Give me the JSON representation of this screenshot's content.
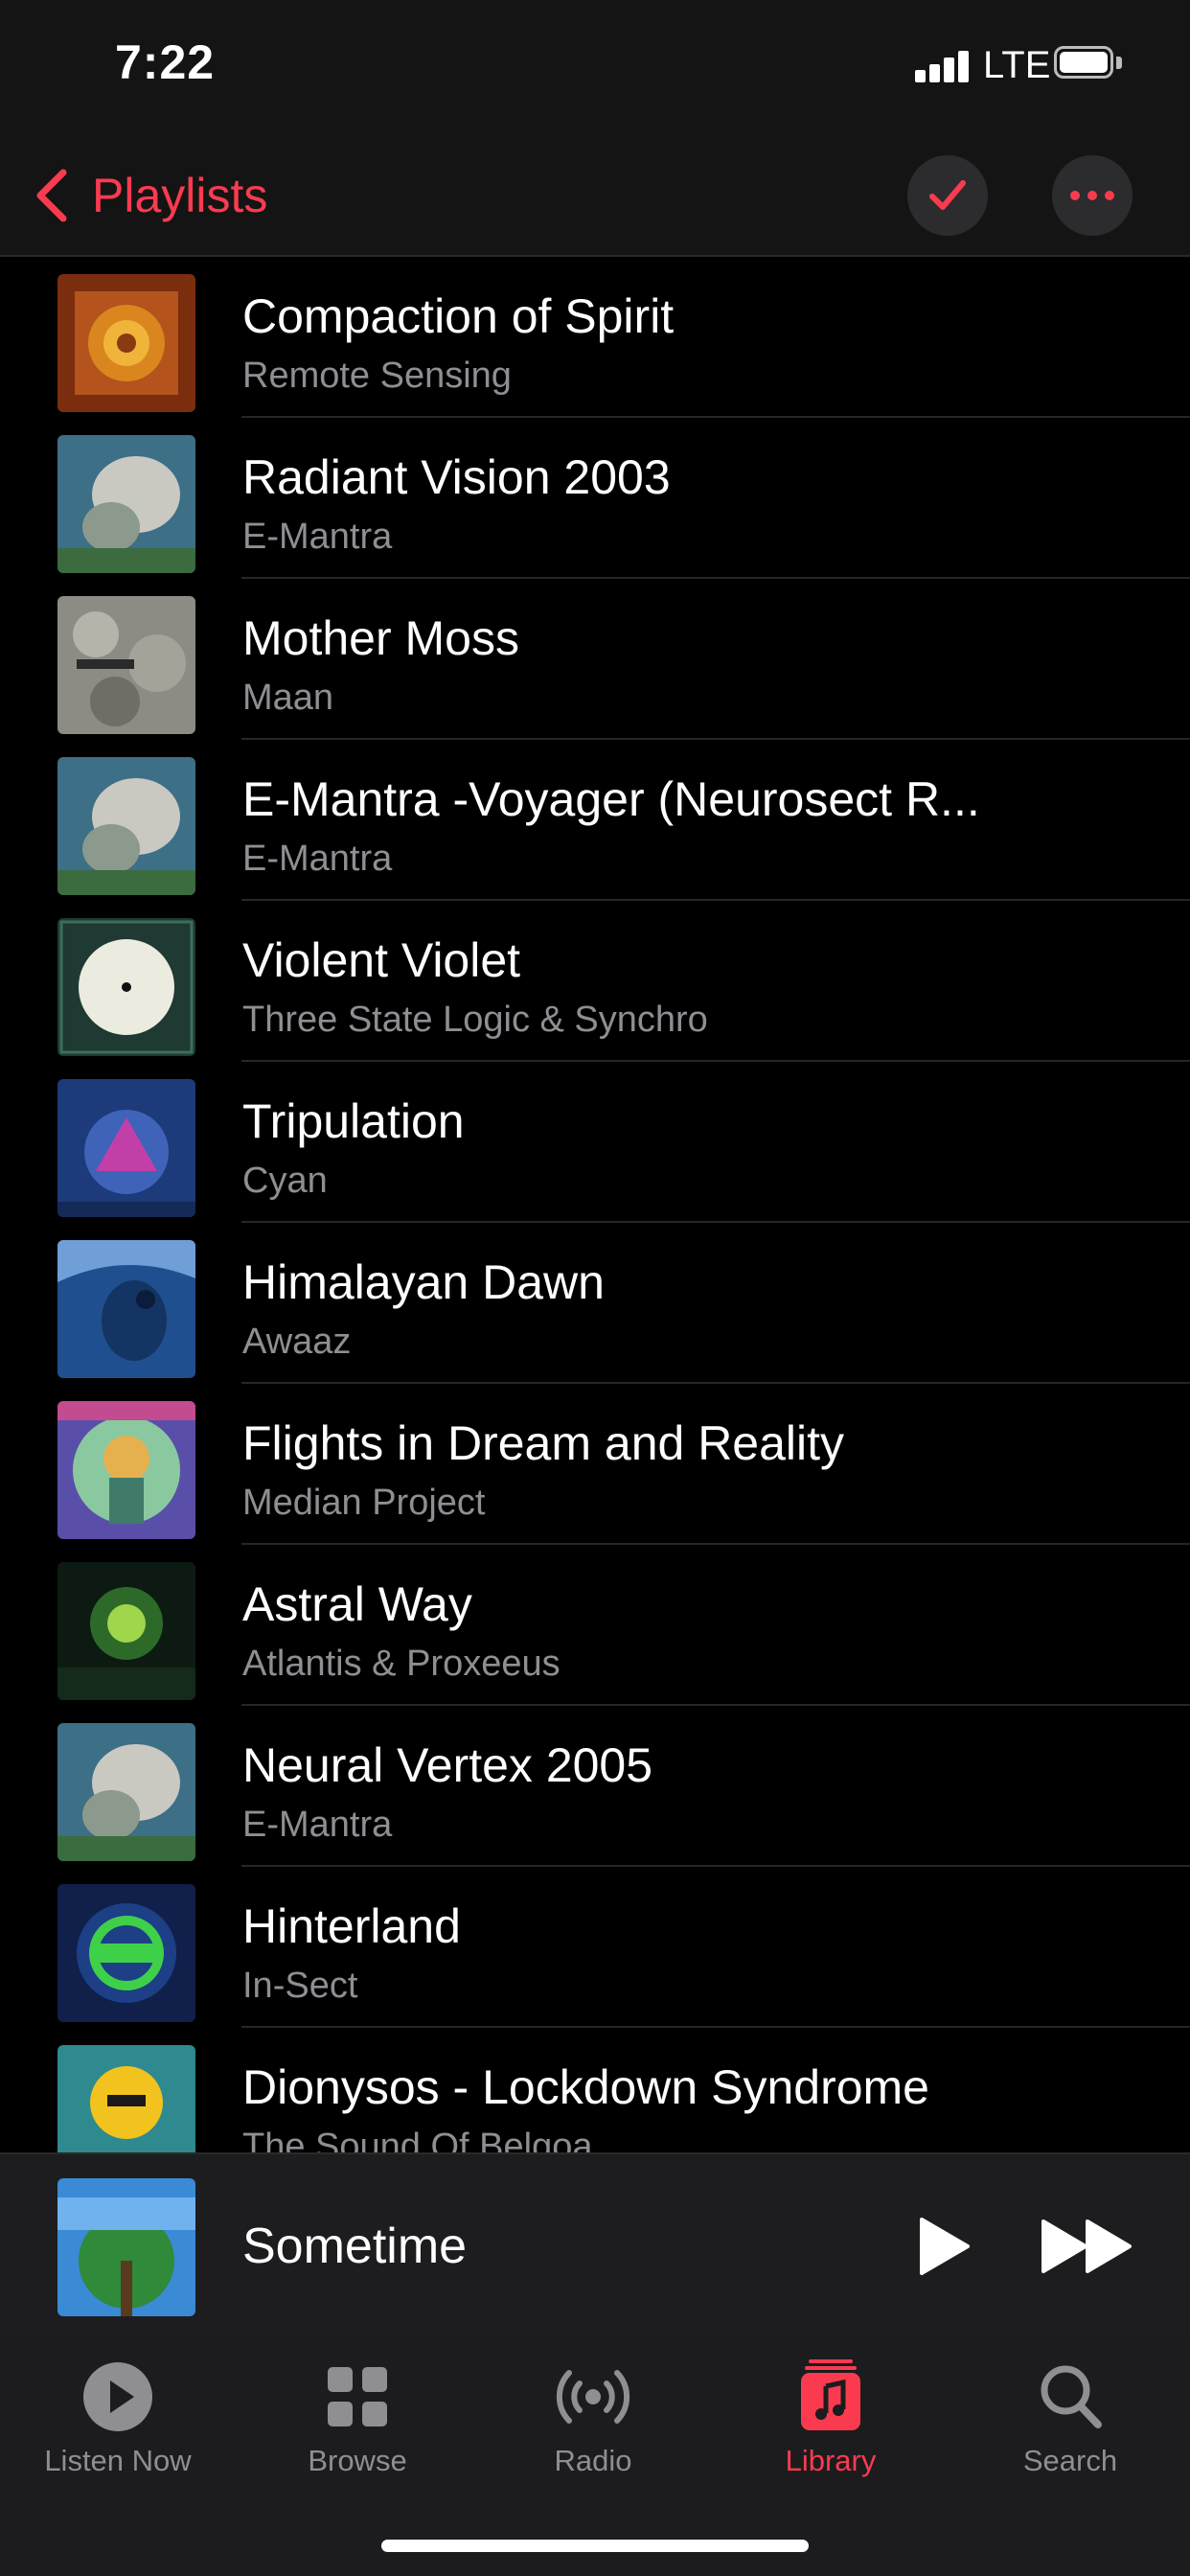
{
  "status_bar": {
    "time": "7:22",
    "network": "LTE",
    "icons": [
      "cellular-signal-icon",
      "battery-icon"
    ]
  },
  "nav": {
    "back_label": "Playlists",
    "back_icon": "chevron-left-icon",
    "select_icon": "checkmark-icon",
    "more_icon": "ellipsis-icon",
    "accent_color": "#fa3b4f"
  },
  "songs": [
    {
      "title": "Compaction of Spirit",
      "artist": "Remote Sensing"
    },
    {
      "title": "Radiant Vision 2003",
      "artist": "E-Mantra"
    },
    {
      "title": "Mother Moss",
      "artist": "Maan"
    },
    {
      "title": "E-Mantra -Voyager (Neurosect R...",
      "artist": "E-Mantra"
    },
    {
      "title": "Violent Violet",
      "artist": "Three State Logic & Synchro"
    },
    {
      "title": "Tripulation",
      "artist": "Cyan"
    },
    {
      "title": "Himalayan Dawn",
      "artist": "Awaaz"
    },
    {
      "title": "Flights in Dream and Reality",
      "artist": "Median Project"
    },
    {
      "title": "Astral Way",
      "artist": "Atlantis & Proxeeus"
    },
    {
      "title": "Neural Vertex 2005",
      "artist": "E-Mantra"
    },
    {
      "title": "Hinterland",
      "artist": "In-Sect"
    },
    {
      "title": "Dionysos - Lockdown Syndrome",
      "artist": "The Sound Of Belgoa"
    }
  ],
  "now_playing": {
    "title": "Sometime",
    "play_icon": "play-icon",
    "forward_icon": "fast-forward-icon"
  },
  "tabs": [
    {
      "label": "Listen Now",
      "icon": "play-circle-icon",
      "active": false
    },
    {
      "label": "Browse",
      "icon": "grid-icon",
      "active": false
    },
    {
      "label": "Radio",
      "icon": "radio-waves-icon",
      "active": false
    },
    {
      "label": "Library",
      "icon": "music-note-icon",
      "active": true
    },
    {
      "label": "Search",
      "icon": "search-icon",
      "active": false
    }
  ]
}
